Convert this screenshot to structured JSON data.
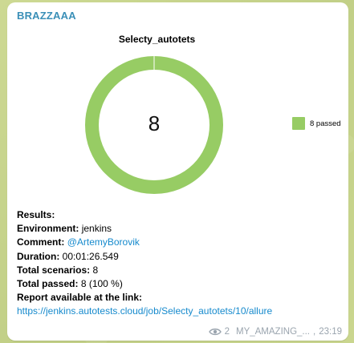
{
  "message": {
    "sender": "BRAZZAAA",
    "sender_color": "#3a8fb7",
    "views": "2",
    "channel": "MY_AMAZING_...",
    "time": "23:19"
  },
  "chart_data": {
    "type": "pie",
    "title": "Selecty_autotets",
    "center_label": "8",
    "categories": [
      "8 passed"
    ],
    "values": [
      8
    ],
    "colors": [
      "#97cc64"
    ],
    "legend_position": "right"
  },
  "results": {
    "heading": "Results:",
    "environment_label": "Environment:",
    "environment_value": "jenkins",
    "comment_label": "Comment:",
    "comment_value": "@ArtemyBorovik",
    "duration_label": "Duration:",
    "duration_value": "00:01:26.549",
    "total_scenarios_label": "Total scenarios:",
    "total_scenarios_value": "8",
    "total_passed_label": "Total passed:",
    "total_passed_value": "8 (100 %)",
    "report_label": "Report available at the link:",
    "report_link": "https://jenkins.autotests.cloud/job/Selecty_autotets/10/allure"
  }
}
